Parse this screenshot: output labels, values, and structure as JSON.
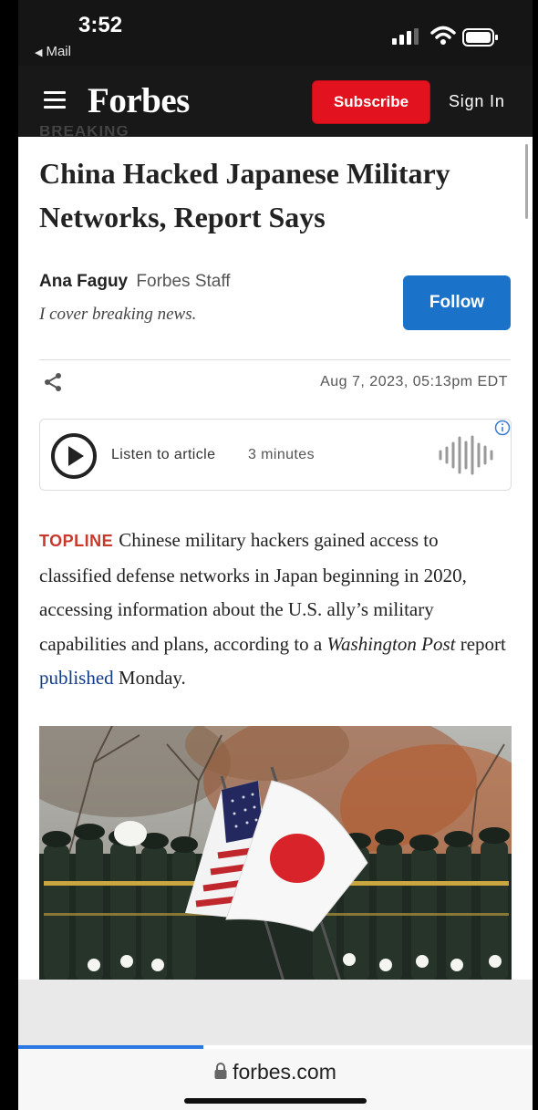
{
  "status_bar": {
    "time": "3:52",
    "back_label": "Mail"
  },
  "header": {
    "logo": "Forbes",
    "subscribe_label": "Subscribe",
    "signin_label": "Sign In"
  },
  "article": {
    "kicker": "BREAKING",
    "title": "China Hacked Japanese Military Networks, Report Says",
    "author": {
      "name": "Ana Faguy",
      "role": "Forbes Staff",
      "bio": "I cover breaking news."
    },
    "follow_label": "Follow",
    "date": "Aug 7, 2023, 05:13pm EDT",
    "audio": {
      "listen_label": "Listen to article",
      "duration": "3 minutes"
    },
    "body": {
      "topline": "TOPLINE",
      "text_1": "Chinese military hackers gained access to classified defense networks in Japan beginning in 2020, accessing information about the U.S. ally’s military capabilities and plans, according to a ",
      "source": "Washington Post",
      "text_2": " report ",
      "link": "published",
      "text_3": " Monday."
    }
  },
  "browser": {
    "url": "forbes.com",
    "progress": 0.36
  },
  "colors": {
    "subscribe": "#e2121e",
    "follow": "#1a73c8",
    "topline": "#c8382c",
    "link": "#123c8a",
    "progress": "#2a78e4"
  },
  "icons": [
    "signal-icon",
    "wifi-icon",
    "battery-icon",
    "hamburger-menu-icon",
    "share-icon",
    "play-icon",
    "audio-wave-icon",
    "info-icon",
    "lock-icon"
  ]
}
